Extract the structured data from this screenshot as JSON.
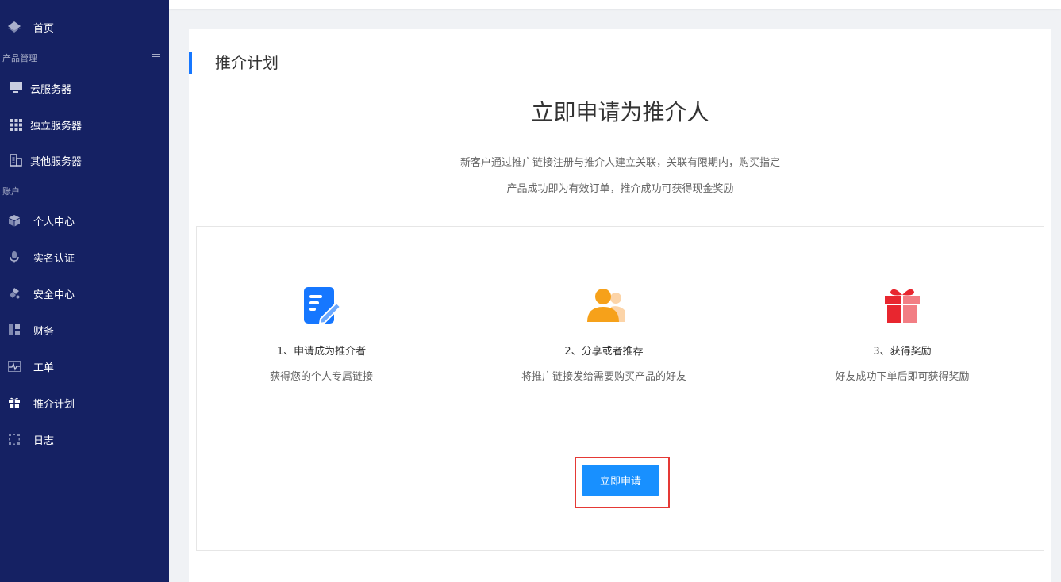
{
  "sidebar": {
    "home": "首页",
    "section_products": "产品管理",
    "cloud": "云服务器",
    "dedicated": "独立服务器",
    "other": "其他服务器",
    "section_account": "账户",
    "personal": "个人中心",
    "verify": "实名认证",
    "security": "安全中心",
    "finance": "财务",
    "ticket": "工单",
    "referral": "推介计划",
    "log": "日志"
  },
  "page": {
    "title": "推介计划",
    "hero_title": "立即申请为推介人",
    "desc_line1": "新客户通过推广链接注册与推介人建立关联，关联有限期内，购买指定",
    "desc_line2": "产品成功即为有效订单，推介成功可获得现金奖励"
  },
  "steps": [
    {
      "title": "1、申请成为推介者",
      "desc": "获得您的个人专属链接",
      "icon": "form-edit-icon"
    },
    {
      "title": "2、分享或者推荐",
      "desc": "将推广链接发给需要购买产品的好友",
      "icon": "users-icon"
    },
    {
      "title": "3、获得奖励",
      "desc": "好友成功下单后即可获得奖励",
      "icon": "gift-icon"
    }
  ],
  "apply_button": "立即申请",
  "colors": {
    "sidebar_bg": "#152163",
    "accent": "#1890ff",
    "highlight_border": "#e53935"
  }
}
